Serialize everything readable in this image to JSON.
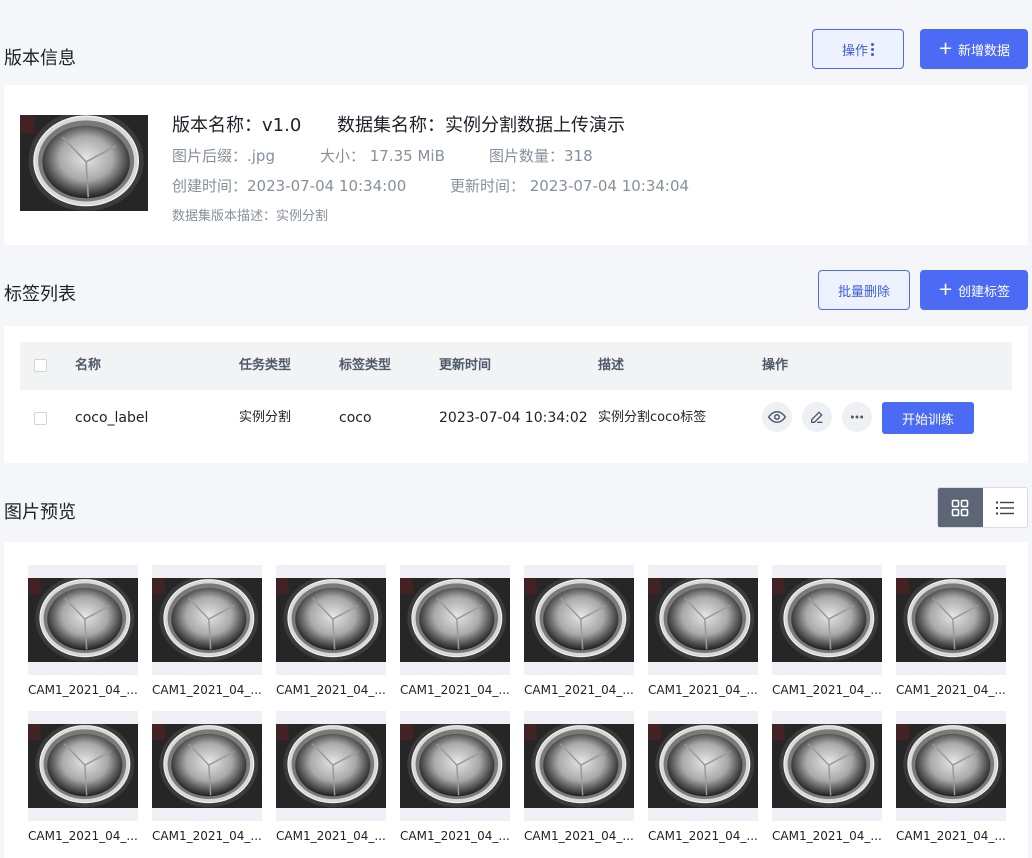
{
  "version_section": {
    "title": "版本信息",
    "ops_button": "操作",
    "add_data_button": "新增数据",
    "version_name": "版本名称：v1.0",
    "dataset_name": "数据集名称：实例分割数据上传演示",
    "suffix": "图片后缀：.jpg",
    "size": "大小： 17.35 MiB",
    "image_count": "图片数量：318",
    "created": "创建时间：2023-07-04 10:34:00",
    "updated": "更新时间： 2023-07-04 10:34:04",
    "description": "数据集版本描述：实例分割"
  },
  "label_section": {
    "title": "标签列表",
    "batch_delete_button": "批量删除",
    "create_label_button": "创建标签",
    "columns": [
      "名称",
      "任务类型",
      "标签类型",
      "更新时间",
      "描述",
      "操作"
    ],
    "rows": [
      {
        "name": "coco_label",
        "task_type": "实例分割",
        "label_type": "coco",
        "updated": "2023-07-04 10:34:02",
        "description": "实例分割coco标签",
        "train_button": "开始训练"
      }
    ]
  },
  "preview_section": {
    "title": "图片预览",
    "view_mode": "grid",
    "images": [
      "CAM1_2021_04_...",
      "CAM1_2021_04_...",
      "CAM1_2021_04_...",
      "CAM1_2021_04_...",
      "CAM1_2021_04_...",
      "CAM1_2021_04_...",
      "CAM1_2021_04_...",
      "CAM1_2021_04_...",
      "CAM1_2021_04_...",
      "CAM1_2021_04_...",
      "CAM1_2021_04_...",
      "CAM1_2021_04_...",
      "CAM1_2021_04_...",
      "CAM1_2021_04_...",
      "CAM1_2021_04_...",
      "CAM1_2021_04_..."
    ]
  },
  "colors": {
    "primary": "#4b6bf5",
    "background": "#f5f6f9",
    "table_header": "#f2f3f5"
  }
}
